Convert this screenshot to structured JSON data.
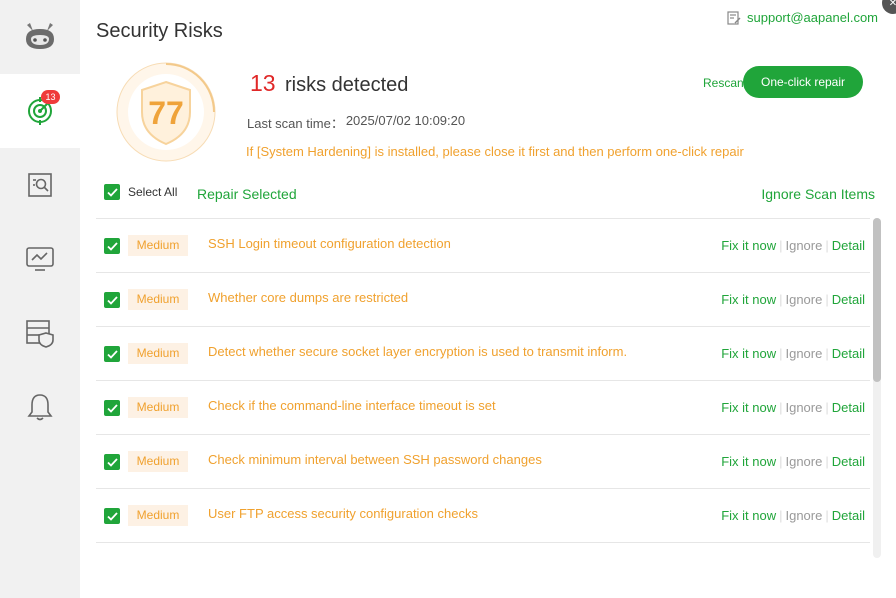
{
  "sidebar": {
    "items": [
      {
        "name": "logo",
        "icon": "cat-logo-icon"
      },
      {
        "name": "security-scan",
        "icon": "radar-icon",
        "badge": "13",
        "active": true
      },
      {
        "name": "file-scan",
        "icon": "file-search-icon"
      },
      {
        "name": "monitor",
        "icon": "monitor-chart-icon"
      },
      {
        "name": "firewall",
        "icon": "server-shield-icon"
      },
      {
        "name": "alerts",
        "icon": "bell-icon"
      }
    ]
  },
  "header": {
    "title": "Security Risks",
    "support_email": "support@aapanel.com"
  },
  "score": {
    "value": "77",
    "risk_count": "13",
    "risk_text": "risks detected",
    "scan_time_label": "Last scan time：",
    "scan_time_value": "2025/07/02 10:09:20",
    "warning": "If [System Hardening] is installed, please close it first and then perform one-click repair"
  },
  "actions": {
    "rescan": "Rescan",
    "one_click_repair": "One-click repair",
    "select_all": "Select All",
    "repair_selected": "Repair Selected",
    "ignore_scan_items": "Ignore Scan Items"
  },
  "row_actions": {
    "fix": "Fix it now",
    "ignore": "Ignore",
    "detail": "Detail"
  },
  "risks": [
    {
      "level": "Medium",
      "title": "SSH Login timeout configuration detection"
    },
    {
      "level": "Medium",
      "title": "Whether core dumps are restricted"
    },
    {
      "level": "Medium",
      "title": "Detect whether secure socket layer encryption is used to transmit inform..."
    },
    {
      "level": "Medium",
      "title": "Check if the command-line interface timeout is set"
    },
    {
      "level": "Medium",
      "title": "Check minimum interval between SSH password changes"
    },
    {
      "level": "Medium",
      "title": "User FTP access security configuration checks"
    }
  ],
  "colors": {
    "accent": "#20a53a",
    "warning": "#f0a12e",
    "danger": "#e02828"
  }
}
